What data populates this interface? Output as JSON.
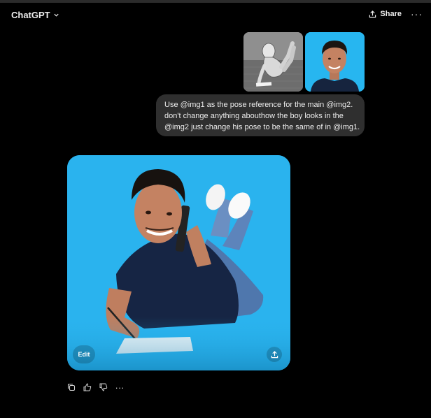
{
  "header": {
    "title": "ChatGPT",
    "title_icon": "chevron-down-icon",
    "share_label": "Share",
    "share_icon": "share-icon",
    "more_icon": "more-icon"
  },
  "message": {
    "lines": [
      "Use @img1 as the pose reference for the main @img2.",
      "don't change anything abouthow the boy looks in the",
      "@img2 just change his pose to be the same of in @img1."
    ]
  },
  "generated": {
    "edit_label": "Edit",
    "download_icon": "download-icon"
  },
  "actions": [
    "copy-icon",
    "thumbs-up-icon",
    "thumbs-down-icon",
    "more-icon"
  ],
  "colors": {
    "background": "#000000",
    "bubble": "#2f2f2f",
    "image_bg": "#2ab3ee"
  }
}
